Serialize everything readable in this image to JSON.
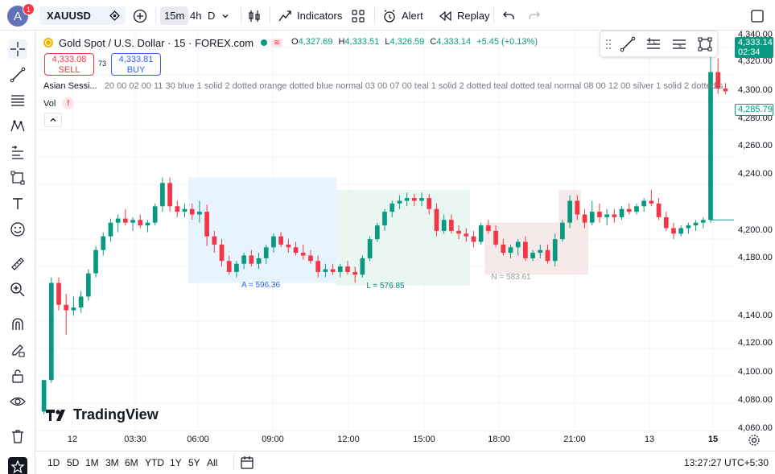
{
  "topbar": {
    "avatar_letter": "A",
    "notification_count": "1",
    "symbol": "XAUUSD",
    "timeframes": [
      "15m",
      "4h",
      "D"
    ],
    "indicators_label": "Indicators",
    "alert_label": "Alert",
    "replay_label": "Replay"
  },
  "legend": {
    "title": "Gold Spot / U.S. Dollar · 15 · FOREX.com",
    "open_label": "O",
    "open": "4,327.69",
    "high_label": "H",
    "high": "4,333.51",
    "low_label": "L",
    "low": "4,326.59",
    "close_label": "C",
    "close": "4,333.14",
    "change": "+5.45 (+0.13%)"
  },
  "trade": {
    "sell_price": "4,333.08",
    "sell_label": "SELL",
    "spread": "73",
    "buy_price": "4,333.81",
    "buy_label": "BUY"
  },
  "session_indicator": {
    "name": "Asian Sessi...",
    "params": "20 00 02 00 11 30 blue 1 solid 2 dotted orange dotted blue normal 03 00 07 00 teal 1 solid 2 dotted teal dotted teal normal 08 00 12 00 silver 1 solid 2 dotted s"
  },
  "volume": {
    "label": "Vol",
    "warning": "!"
  },
  "price_axis": {
    "labels": [
      "4,340.00",
      "4,320.00",
      "4,300.00",
      "4,280.00",
      "4,260.00",
      "4,240.00",
      "4,200.00",
      "4,180.00",
      "4,140.00",
      "4,120.00",
      "4,100.00",
      "4,080.00",
      "4,060.00"
    ],
    "current_price": "4,333.14",
    "countdown": "02:34",
    "marker_price": "4,285.79"
  },
  "time_axis": {
    "labels": [
      "12",
      "03:30",
      "06:00",
      "09:00",
      "12:00",
      "15:00",
      "18:00",
      "21:00",
      "13",
      "15"
    ]
  },
  "session_boxes": {
    "asia_label": "A = 596.36",
    "london_label": "L = 576.85",
    "ny_label": "N = 583.61"
  },
  "bottombar": {
    "ranges": [
      "1D",
      "5D",
      "1M",
      "3M",
      "6M",
      "YTD",
      "1Y",
      "5Y",
      "All"
    ],
    "clock": "13:27:27 UTC+5:30"
  },
  "branding": {
    "logo_text": "TradingView"
  },
  "colors": {
    "up": "#089981",
    "down": "#f23645",
    "asia_box": "#e3f2fd",
    "london_box": "#e6f4f0",
    "ny_box": "#f3e5e5"
  },
  "chart_data": {
    "type": "candlestick",
    "symbol": "XAUUSD",
    "interval": "15",
    "candles": [
      {
        "o": 4074,
        "h": 4090,
        "l": 4072,
        "c": 4097
      },
      {
        "o": 4097,
        "h": 4172,
        "l": 4095,
        "c": 4168
      },
      {
        "o": 4168,
        "h": 4172,
        "l": 4148,
        "c": 4152
      },
      {
        "o": 4152,
        "h": 4160,
        "l": 4130,
        "c": 4148
      },
      {
        "o": 4148,
        "h": 4158,
        "l": 4144,
        "c": 4150
      },
      {
        "o": 4150,
        "h": 4162,
        "l": 4146,
        "c": 4158
      },
      {
        "o": 4158,
        "h": 4178,
        "l": 4155,
        "c": 4175
      },
      {
        "o": 4175,
        "h": 4195,
        "l": 4172,
        "c": 4192
      },
      {
        "o": 4192,
        "h": 4205,
        "l": 4188,
        "c": 4202
      },
      {
        "o": 4202,
        "h": 4215,
        "l": 4198,
        "c": 4212
      },
      {
        "o": 4212,
        "h": 4218,
        "l": 4205,
        "c": 4215
      },
      {
        "o": 4215,
        "h": 4222,
        "l": 4210,
        "c": 4212
      },
      {
        "o": 4212,
        "h": 4216,
        "l": 4206,
        "c": 4214
      },
      {
        "o": 4214,
        "h": 4218,
        "l": 4208,
        "c": 4210
      },
      {
        "o": 4210,
        "h": 4214,
        "l": 4205,
        "c": 4212
      },
      {
        "o": 4212,
        "h": 4226,
        "l": 4210,
        "c": 4224
      },
      {
        "o": 4224,
        "h": 4245,
        "l": 4220,
        "c": 4241
      },
      {
        "o": 4241,
        "h": 4245,
        "l": 4220,
        "c": 4224
      },
      {
        "o": 4224,
        "h": 4228,
        "l": 4216,
        "c": 4220
      },
      {
        "o": 4220,
        "h": 4226,
        "l": 4216,
        "c": 4222
      },
      {
        "o": 4222,
        "h": 4226,
        "l": 4214,
        "c": 4218
      },
      {
        "o": 4218,
        "h": 4228,
        "l": 4212,
        "c": 4220
      },
      {
        "o": 4220,
        "h": 4225,
        "l": 4195,
        "c": 4202
      },
      {
        "o": 4202,
        "h": 4206,
        "l": 4190,
        "c": 4196
      },
      {
        "o": 4196,
        "h": 4200,
        "l": 4180,
        "c": 4184
      },
      {
        "o": 4184,
        "h": 4188,
        "l": 4174,
        "c": 4176
      },
      {
        "o": 4176,
        "h": 4184,
        "l": 4172,
        "c": 4182
      },
      {
        "o": 4182,
        "h": 4190,
        "l": 4178,
        "c": 4188
      },
      {
        "o": 4188,
        "h": 4192,
        "l": 4180,
        "c": 4182
      },
      {
        "o": 4182,
        "h": 4190,
        "l": 4178,
        "c": 4186
      },
      {
        "o": 4186,
        "h": 4196,
        "l": 4182,
        "c": 4194
      },
      {
        "o": 4194,
        "h": 4204,
        "l": 4190,
        "c": 4202
      },
      {
        "o": 4202,
        "h": 4205,
        "l": 4194,
        "c": 4196
      },
      {
        "o": 4196,
        "h": 4200,
        "l": 4190,
        "c": 4194
      },
      {
        "o": 4194,
        "h": 4198,
        "l": 4188,
        "c": 4190
      },
      {
        "o": 4190,
        "h": 4196,
        "l": 4185,
        "c": 4188
      },
      {
        "o": 4188,
        "h": 4192,
        "l": 4182,
        "c": 4184
      },
      {
        "o": 4184,
        "h": 4188,
        "l": 4172,
        "c": 4176
      },
      {
        "o": 4176,
        "h": 4182,
        "l": 4172,
        "c": 4178
      },
      {
        "o": 4178,
        "h": 4182,
        "l": 4174,
        "c": 4176
      },
      {
        "o": 4176,
        "h": 4182,
        "l": 4172,
        "c": 4180
      },
      {
        "o": 4180,
        "h": 4184,
        "l": 4174,
        "c": 4176
      },
      {
        "o": 4176,
        "h": 4180,
        "l": 4168,
        "c": 4174
      },
      {
        "o": 4174,
        "h": 4188,
        "l": 4172,
        "c": 4186
      },
      {
        "o": 4186,
        "h": 4202,
        "l": 4184,
        "c": 4200
      },
      {
        "o": 4200,
        "h": 4212,
        "l": 4198,
        "c": 4210
      },
      {
        "o": 4210,
        "h": 4222,
        "l": 4206,
        "c": 4220
      },
      {
        "o": 4220,
        "h": 4228,
        "l": 4216,
        "c": 4226
      },
      {
        "o": 4226,
        "h": 4232,
        "l": 4222,
        "c": 4228
      },
      {
        "o": 4228,
        "h": 4234,
        "l": 4224,
        "c": 4230
      },
      {
        "o": 4230,
        "h": 4233,
        "l": 4224,
        "c": 4228
      },
      {
        "o": 4228,
        "h": 4234,
        "l": 4224,
        "c": 4230
      },
      {
        "o": 4230,
        "h": 4233,
        "l": 4218,
        "c": 4222
      },
      {
        "o": 4222,
        "h": 4226,
        "l": 4202,
        "c": 4206
      },
      {
        "o": 4206,
        "h": 4218,
        "l": 4204,
        "c": 4214
      },
      {
        "o": 4214,
        "h": 4218,
        "l": 4204,
        "c": 4206
      },
      {
        "o": 4206,
        "h": 4210,
        "l": 4200,
        "c": 4204
      },
      {
        "o": 4204,
        "h": 4208,
        "l": 4198,
        "c": 4202
      },
      {
        "o": 4202,
        "h": 4206,
        "l": 4194,
        "c": 4198
      },
      {
        "o": 4198,
        "h": 4212,
        "l": 4196,
        "c": 4210
      },
      {
        "o": 4210,
        "h": 4214,
        "l": 4204,
        "c": 4206
      },
      {
        "o": 4206,
        "h": 4210,
        "l": 4194,
        "c": 4196
      },
      {
        "o": 4196,
        "h": 4200,
        "l": 4188,
        "c": 4190
      },
      {
        "o": 4190,
        "h": 4196,
        "l": 4186,
        "c": 4194
      },
      {
        "o": 4194,
        "h": 4200,
        "l": 4188,
        "c": 4198
      },
      {
        "o": 4198,
        "h": 4202,
        "l": 4184,
        "c": 4186
      },
      {
        "o": 4186,
        "h": 4192,
        "l": 4184,
        "c": 4190
      },
      {
        "o": 4190,
        "h": 4196,
        "l": 4186,
        "c": 4192
      },
      {
        "o": 4192,
        "h": 4196,
        "l": 4182,
        "c": 4184
      },
      {
        "o": 4184,
        "h": 4204,
        "l": 4180,
        "c": 4200
      },
      {
        "o": 4200,
        "h": 4214,
        "l": 4198,
        "c": 4212
      },
      {
        "o": 4212,
        "h": 4232,
        "l": 4208,
        "c": 4228
      },
      {
        "o": 4228,
        "h": 4232,
        "l": 4214,
        "c": 4218
      },
      {
        "o": 4218,
        "h": 4222,
        "l": 4208,
        "c": 4212
      },
      {
        "o": 4212,
        "h": 4228,
        "l": 4210,
        "c": 4220
      },
      {
        "o": 4220,
        "h": 4226,
        "l": 4212,
        "c": 4216
      },
      {
        "o": 4216,
        "h": 4222,
        "l": 4210,
        "c": 4218
      },
      {
        "o": 4218,
        "h": 4222,
        "l": 4212,
        "c": 4216
      },
      {
        "o": 4216,
        "h": 4224,
        "l": 4214,
        "c": 4222
      },
      {
        "o": 4222,
        "h": 4226,
        "l": 4218,
        "c": 4220
      },
      {
        "o": 4220,
        "h": 4226,
        "l": 4218,
        "c": 4224
      },
      {
        "o": 4224,
        "h": 4230,
        "l": 4220,
        "c": 4228
      },
      {
        "o": 4228,
        "h": 4236,
        "l": 4224,
        "c": 4226
      },
      {
        "o": 4226,
        "h": 4230,
        "l": 4214,
        "c": 4216
      },
      {
        "o": 4216,
        "h": 4220,
        "l": 4206,
        "c": 4208
      },
      {
        "o": 4208,
        "h": 4212,
        "l": 4200,
        "c": 4204
      },
      {
        "o": 4204,
        "h": 4210,
        "l": 4202,
        "c": 4208
      },
      {
        "o": 4208,
        "h": 4212,
        "l": 4204,
        "c": 4210
      },
      {
        "o": 4210,
        "h": 4214,
        "l": 4206,
        "c": 4212
      },
      {
        "o": 4212,
        "h": 4216,
        "l": 4208,
        "c": 4214
      },
      {
        "o": 4214,
        "h": 4340,
        "l": 4212,
        "c": 4322
      },
      {
        "o": 4322,
        "h": 4332,
        "l": 4306,
        "c": 4310
      },
      {
        "o": 4310,
        "h": 4314,
        "l": 4306,
        "c": 4308
      }
    ],
    "price_range": [
      4056,
      4350
    ]
  }
}
